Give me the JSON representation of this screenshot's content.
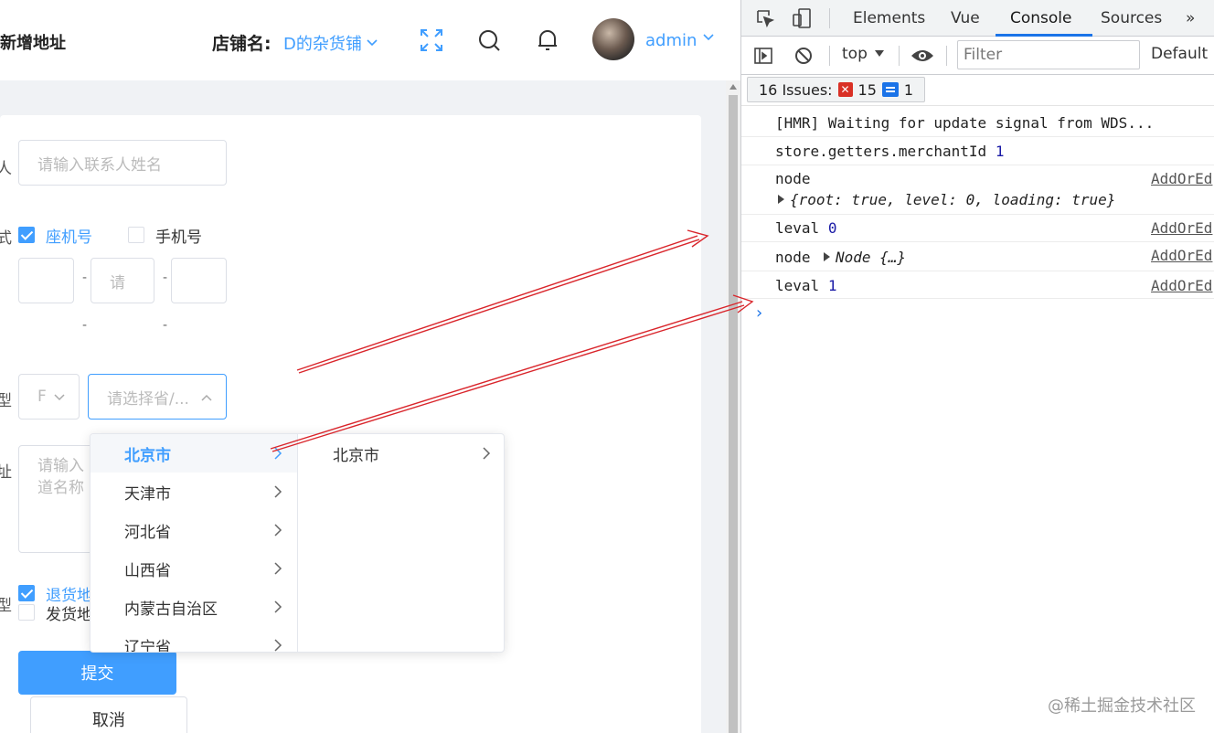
{
  "header": {
    "page_title": "新增地址",
    "shop_label": "店铺名:",
    "shop_value": "D的杂货铺",
    "username": "admin"
  },
  "form": {
    "side_labels": [
      "人",
      "式",
      "型",
      "址",
      "型"
    ],
    "contact_placeholder": "请输入联系人姓名",
    "phone_type_options": [
      {
        "label": "座机号",
        "checked": true
      },
      {
        "label": "手机号",
        "checked": false
      }
    ],
    "phone_dash": "-",
    "phone_field_hints": [
      "",
      "请",
      ""
    ],
    "region_select_value": "F",
    "region_cascader_placeholder": "请选择省/...",
    "address_placeholder_line1": "请输入",
    "address_placeholder_line2": "道名称",
    "address_type_options": [
      {
        "label": "退货地",
        "checked": true
      },
      {
        "label": "发货地",
        "checked": false
      }
    ],
    "submit_label": "提交",
    "cancel_label": "取消"
  },
  "cascader": {
    "column1": [
      "北京市",
      "天津市",
      "河北省",
      "山西省",
      "内蒙古自治区",
      "辽宁省"
    ],
    "column1_active_index": 0,
    "column2": [
      "北京市"
    ]
  },
  "devtools": {
    "tabs": [
      "Elements",
      "Vue",
      "Console",
      "Sources"
    ],
    "active_tab": "Console",
    "more_tabs": "»",
    "context": "top",
    "filter_placeholder": "Filter",
    "levels": "Default le",
    "issues": {
      "label": "16 Issues:",
      "errors": "15",
      "info": "1"
    },
    "logs": [
      {
        "text": "[HMR] Waiting for update signal from WDS...",
        "value": "",
        "source": ""
      },
      {
        "text": "store.getters.merchantId",
        "value": "1",
        "source": ""
      },
      {
        "text": "node",
        "value": "",
        "source": "AddOrEd",
        "object": "{root: true, level: 0, loading: true}"
      },
      {
        "text": "leval",
        "value": "0",
        "source": "AddOrEd"
      },
      {
        "text": "node",
        "value": "",
        "source": "AddOrEd",
        "inline_object": "Node {…}"
      },
      {
        "text": "leval",
        "value": "1",
        "source": "AddOrEd"
      }
    ],
    "prompt": "›"
  },
  "watermark": "@稀土掘金技术社区",
  "colors": {
    "accent": "#409eff",
    "devtools_blue": "#1a73e8",
    "annotation_red": "#d9252b"
  }
}
